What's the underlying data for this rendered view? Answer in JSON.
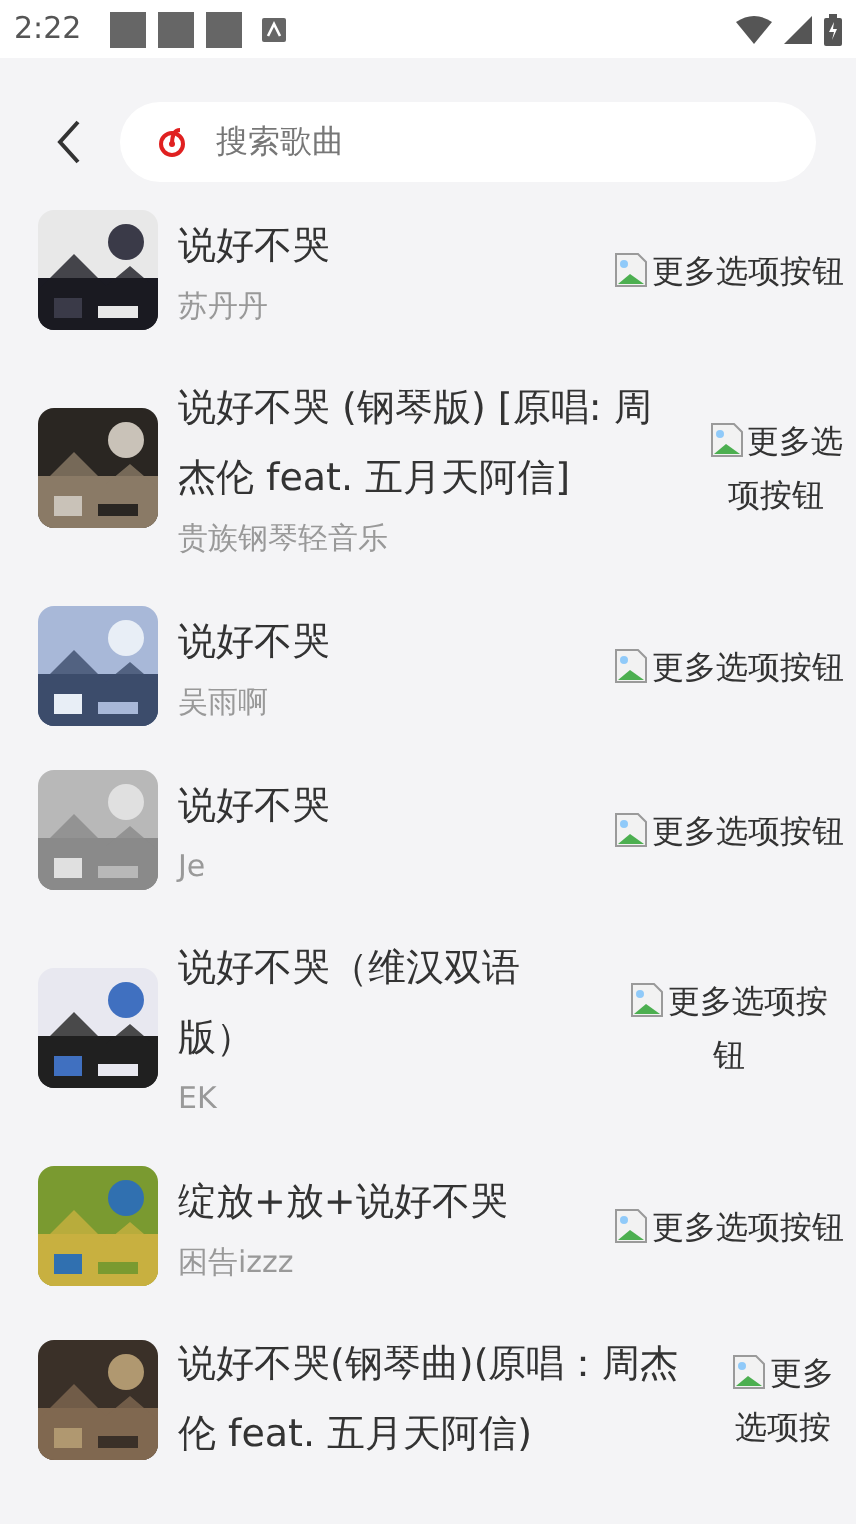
{
  "status_bar": {
    "time": "2:22"
  },
  "search": {
    "placeholder": "搜索歌曲"
  },
  "songs": [
    {
      "title": "说好不哭",
      "artist": "苏丹丹",
      "more": "更多选项按钮"
    },
    {
      "title": "说好不哭 (钢琴版) [原唱: 周杰伦 feat. 五月天阿信]",
      "artist": "贵族钢琴轻音乐",
      "more": "更多选项按钮"
    },
    {
      "title": "说好不哭",
      "artist": "吴雨啊",
      "more": "更多选项按钮"
    },
    {
      "title": "说好不哭",
      "artist": "Je",
      "more": "更多选项按钮"
    },
    {
      "title": "说好不哭（维汉双语版）",
      "artist": "EK",
      "more": "更多选项按钮"
    },
    {
      "title": "绽放+放+说好不哭",
      "artist": "困告izzz",
      "more": "更多选项按钮"
    },
    {
      "title": "说好不哭(钢琴曲)(原唱：周杰伦 feat. 五月天阿信)",
      "more": "更多选项按"
    }
  ]
}
